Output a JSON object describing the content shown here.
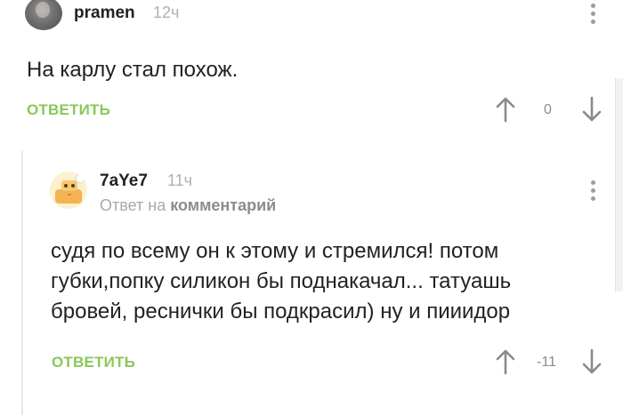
{
  "comment1": {
    "username": "pramen",
    "time": "12ч",
    "text": "На карлу стал похож.",
    "reply_label": "ОТВЕТИТЬ",
    "score": "0",
    "avatar_icon": "user-avatar-icon",
    "menu_icon": "more-vertical-icon"
  },
  "comment2": {
    "username": "7aYe7",
    "time": "11ч",
    "reply_prefix": "Ответ на",
    "reply_target": "комментарий",
    "text_lines": [
      "судя по всему он к этому и стремился! потом",
      "губки,попку силикон бы поднакачал... татуашь",
      "бровей, реснички бы подкрасил) ну и пииидор"
    ],
    "reply_label": "ОТВЕТИТЬ",
    "score": "-11",
    "avatar_icon": "robot-avatar-icon",
    "menu_icon": "more-vertical-icon"
  },
  "colors": {
    "accent_green": "#8ac858",
    "text": "#222222",
    "muted": "#b0b0b0"
  }
}
